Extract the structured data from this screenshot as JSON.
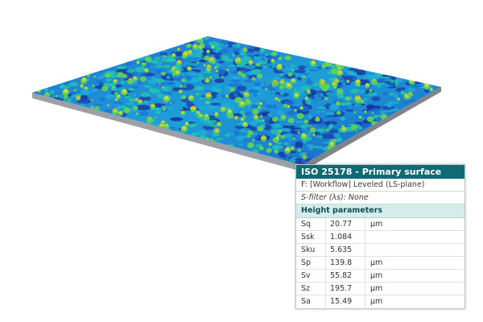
{
  "panel": {
    "title": "ISO 25178 - Primary surface",
    "filter_line": "F: [Workflow] Leveled (LS-plane)",
    "s_filter_line": "S-filter (λs): None",
    "section_title": "Height parameters",
    "params": [
      {
        "name": "Sq",
        "value": "20.77",
        "unit": "µm"
      },
      {
        "name": "Ssk",
        "value": "1.084",
        "unit": ""
      },
      {
        "name": "Sku",
        "value": "5.635",
        "unit": ""
      },
      {
        "name": "Sp",
        "value": "139.8",
        "unit": "µm"
      },
      {
        "name": "Sv",
        "value": "55.82",
        "unit": "µm"
      },
      {
        "name": "Sz",
        "value": "195.7",
        "unit": "µm"
      },
      {
        "name": "Sa",
        "value": "15.49",
        "unit": "µm"
      }
    ]
  },
  "colors": {
    "title_bg": "#0f6b73",
    "section_bg": "#d5ecec",
    "surface_palette": [
      "#1d3fb0",
      "#1e6fd6",
      "#1fb0d6",
      "#25c9a6",
      "#5fd15a",
      "#c9d93a",
      "#e6b02a",
      "#d66a2a"
    ]
  }
}
